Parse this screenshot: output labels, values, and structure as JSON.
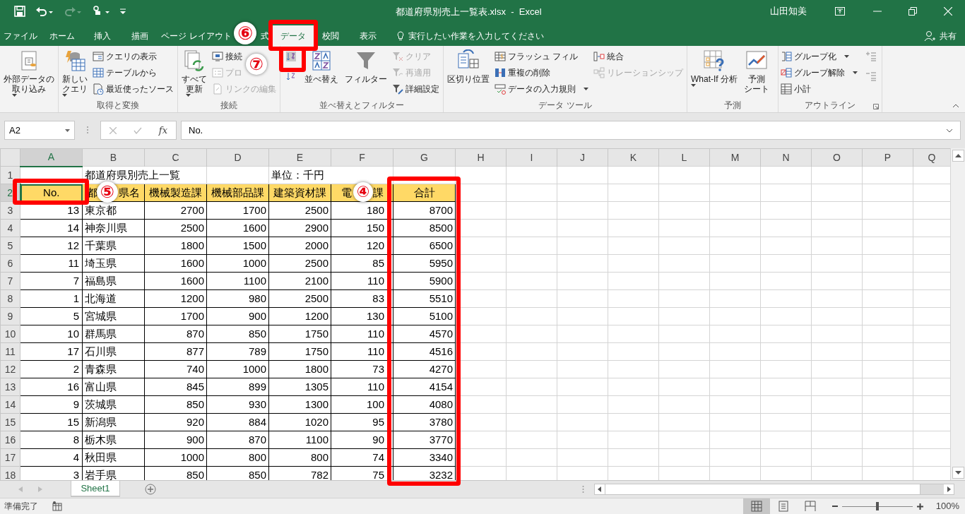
{
  "window": {
    "title": "都道府県別売上一覧表.xlsx  -  Excel",
    "user": "山田知美"
  },
  "ribbon_tabs": [
    {
      "label": "ファイル",
      "selected": false
    },
    {
      "label": "ホーム",
      "selected": false
    },
    {
      "label": "挿入",
      "selected": false
    },
    {
      "label": "描画",
      "selected": false
    },
    {
      "label": "ページ レイアウト",
      "selected": false
    },
    {
      "label": "式",
      "selected": false
    },
    {
      "label": "データ",
      "selected": true
    },
    {
      "label": "校閲",
      "selected": false
    },
    {
      "label": "表示",
      "selected": false
    }
  ],
  "tell_me": {
    "placeholder": "実行したい作業を入力してください"
  },
  "share": "共有",
  "ribbon_groups": [
    {
      "items": [
        {
          "kind": "large",
          "lines": [
            "外部データの",
            "取り込み"
          ],
          "dropdown": true,
          "disabled": false
        }
      ]
    },
    {
      "label": "取得と変換",
      "items": [
        {
          "kind": "large",
          "lines": [
            "新しい",
            "クエリ"
          ],
          "dropdown": true,
          "disabled": false
        },
        {
          "kind": "small",
          "label": "クエリの表示",
          "dropdown": false,
          "disabled": false
        },
        {
          "kind": "small",
          "label": "テーブルから",
          "dropdown": false,
          "disabled": false
        },
        {
          "kind": "small",
          "label": "最近使ったソース",
          "dropdown": false,
          "disabled": false
        }
      ]
    },
    {
      "label": "接続",
      "items": [
        {
          "kind": "large",
          "lines": [
            "すべて",
            "更新"
          ],
          "dropdown": true,
          "disabled": false
        },
        {
          "kind": "small",
          "label": "接続",
          "dropdown": false,
          "disabled": false
        },
        {
          "kind": "small",
          "label": "プロ",
          "dropdown": false,
          "disabled": true
        },
        {
          "kind": "small",
          "label": "リンクの編集",
          "dropdown": false,
          "disabled": true
        }
      ]
    },
    {
      "label": "並べ替えとフィルター",
      "items": [
        {
          "kind": "icon",
          "disabled": false
        },
        {
          "kind": "icon",
          "disabled": false
        },
        {
          "kind": "large",
          "lines": [
            "並べ替え"
          ],
          "dropdown": false,
          "disabled": false
        },
        {
          "kind": "large",
          "lines": [
            "フィルター"
          ],
          "dropdown": false,
          "disabled": false
        },
        {
          "kind": "small",
          "label": "クリア",
          "dropdown": false,
          "disabled": true
        },
        {
          "kind": "small",
          "label": "再適用",
          "dropdown": false,
          "disabled": true
        },
        {
          "kind": "small",
          "label": "詳細設定",
          "dropdown": false,
          "disabled": false
        }
      ]
    },
    {
      "label": "データ ツール",
      "items": [
        {
          "kind": "large",
          "lines": [
            "区切り位置"
          ],
          "dropdown": false,
          "disabled": false
        },
        {
          "kind": "small",
          "label": "フラッシュ フィル",
          "dropdown": false,
          "disabled": false
        },
        {
          "kind": "small",
          "label": "重複の削除",
          "dropdown": false,
          "disabled": false
        },
        {
          "kind": "small",
          "label": "データの入力規則",
          "dropdown": true,
          "disabled": false
        },
        {
          "kind": "small",
          "label": "統合",
          "dropdown": false,
          "disabled": false
        },
        {
          "kind": "small",
          "label": "リレーションシップ",
          "dropdown": false,
          "disabled": true
        }
      ]
    },
    {
      "label": "予測",
      "items": [
        {
          "kind": "large",
          "lines": [
            "What-If 分析"
          ],
          "dropdown": true,
          "disabled": false
        },
        {
          "kind": "large",
          "lines": [
            "予測",
            "シート"
          ],
          "dropdown": false,
          "disabled": false
        }
      ]
    },
    {
      "label": "アウトライン",
      "items": [
        {
          "kind": "small",
          "label": "グループ化",
          "dropdown": true,
          "disabled": false
        },
        {
          "kind": "small",
          "label": "グループ解除",
          "dropdown": true,
          "disabled": false
        },
        {
          "kind": "small",
          "label": "小計",
          "dropdown": false,
          "disabled": false
        },
        {
          "kind": "icon",
          "disabled": true
        },
        {
          "kind": "icon",
          "disabled": true
        }
      ]
    }
  ],
  "formula_bar": {
    "name_box": "A2",
    "function_button": "fx",
    "formula": "No."
  },
  "columns": [
    {
      "letter": "A",
      "selected": true
    },
    {
      "letter": "B",
      "selected": false
    },
    {
      "letter": "C",
      "selected": false
    },
    {
      "letter": "D",
      "selected": false
    },
    {
      "letter": "E",
      "selected": false
    },
    {
      "letter": "F",
      "selected": false
    },
    {
      "letter": "G",
      "selected": false
    },
    {
      "letter": "H",
      "selected": false
    },
    {
      "letter": "I",
      "selected": false
    },
    {
      "letter": "J",
      "selected": false
    },
    {
      "letter": "K",
      "selected": false
    },
    {
      "letter": "L",
      "selected": false
    },
    {
      "letter": "M",
      "selected": false
    },
    {
      "letter": "N",
      "selected": false
    },
    {
      "letter": "O",
      "selected": false
    },
    {
      "letter": "P",
      "selected": false
    },
    {
      "letter": "Q",
      "selected": false
    }
  ],
  "rows": [
    {
      "num": "1",
      "kind": "title",
      "selected": false,
      "cells": [
        null,
        "都道府県別売上一覧",
        null,
        null,
        "単位：千円",
        null,
        null
      ]
    },
    {
      "num": "2",
      "kind": "header",
      "selected": true,
      "cells": [
        "No.",
        "都　　県名",
        "機械製造課",
        "機械部品課",
        "建築資材課",
        "電　　課",
        "合計"
      ]
    },
    {
      "num": "3",
      "kind": "data",
      "selected": false,
      "cells": [
        "13",
        "東京都",
        "2700",
        "1700",
        "2500",
        "180",
        "8700"
      ]
    },
    {
      "num": "4",
      "kind": "data",
      "selected": false,
      "cells": [
        "14",
        "神奈川県",
        "2500",
        "1600",
        "2900",
        "150",
        "8500"
      ]
    },
    {
      "num": "5",
      "kind": "data",
      "selected": false,
      "cells": [
        "12",
        "千葉県",
        "1800",
        "1500",
        "2000",
        "120",
        "6500"
      ]
    },
    {
      "num": "6",
      "kind": "data",
      "selected": false,
      "cells": [
        "11",
        "埼玉県",
        "1600",
        "1000",
        "2500",
        "85",
        "5950"
      ]
    },
    {
      "num": "7",
      "kind": "data",
      "selected": false,
      "cells": [
        "7",
        "福島県",
        "1600",
        "1100",
        "2100",
        "110",
        "5900"
      ]
    },
    {
      "num": "8",
      "kind": "data",
      "selected": false,
      "cells": [
        "1",
        "北海道",
        "1200",
        "980",
        "2500",
        "83",
        "5510"
      ]
    },
    {
      "num": "9",
      "kind": "data",
      "selected": false,
      "cells": [
        "5",
        "宮城県",
        "1700",
        "900",
        "1200",
        "130",
        "5100"
      ]
    },
    {
      "num": "10",
      "kind": "data",
      "selected": false,
      "cells": [
        "10",
        "群馬県",
        "870",
        "850",
        "1750",
        "110",
        "4570"
      ]
    },
    {
      "num": "11",
      "kind": "data",
      "selected": false,
      "cells": [
        "17",
        "石川県",
        "877",
        "789",
        "1750",
        "110",
        "4516"
      ]
    },
    {
      "num": "12",
      "kind": "data",
      "selected": false,
      "cells": [
        "2",
        "青森県",
        "740",
        "1000",
        "1800",
        "73",
        "4270"
      ]
    },
    {
      "num": "13",
      "kind": "data",
      "selected": false,
      "cells": [
        "16",
        "富山県",
        "845",
        "899",
        "1305",
        "110",
        "4154"
      ]
    },
    {
      "num": "14",
      "kind": "data",
      "selected": false,
      "cells": [
        "9",
        "茨城県",
        "850",
        "930",
        "1300",
        "100",
        "4080"
      ]
    },
    {
      "num": "15",
      "kind": "data",
      "selected": false,
      "cells": [
        "15",
        "新潟県",
        "920",
        "884",
        "1020",
        "95",
        "3780"
      ]
    },
    {
      "num": "16",
      "kind": "data",
      "selected": false,
      "cells": [
        "8",
        "栃木県",
        "900",
        "870",
        "1100",
        "90",
        "3770"
      ]
    },
    {
      "num": "17",
      "kind": "data",
      "selected": false,
      "cells": [
        "4",
        "秋田県",
        "1000",
        "800",
        "800",
        "74",
        "3340"
      ]
    },
    {
      "num": "18",
      "kind": "data",
      "selected": false,
      "cells": [
        "3",
        "岩手県",
        "850",
        "850",
        "782",
        "75",
        "3232"
      ]
    }
  ],
  "sheet_tabs": [
    {
      "label": "Sheet1",
      "selected": true
    }
  ],
  "status_bar": {
    "text": "準備完了",
    "views": [
      {
        "selected": true
      },
      {
        "selected": false
      },
      {
        "selected": false
      }
    ],
    "zoom_slider": {
      "level": 0.5
    },
    "zoom": "100%"
  },
  "annotations": [
    {
      "kind": "frame"
    },
    {
      "kind": "badge",
      "label": "⑥"
    },
    {
      "kind": "frame"
    },
    {
      "kind": "badge",
      "label": "⑦"
    },
    {
      "kind": "frame"
    },
    {
      "kind": "badge",
      "label": "⑤"
    },
    {
      "kind": "badge",
      "label": "④"
    },
    {
      "kind": "frame"
    }
  ]
}
